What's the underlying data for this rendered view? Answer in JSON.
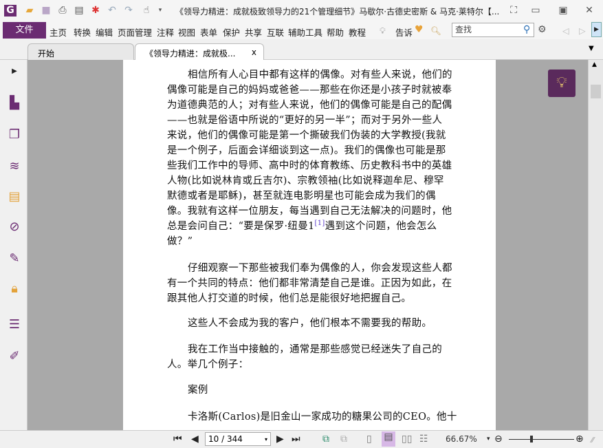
{
  "window": {
    "title": "《领导力精进：成就极致领导力的21个管理细节》马歇尔·古德史密斯 & 马克·莱特尔【..."
  },
  "menu": {
    "file": "文件",
    "items": [
      "主页",
      "转换",
      "编辑",
      "页面管理",
      "注释",
      "视图",
      "表单",
      "保护",
      "共享",
      "互联",
      "辅助工具",
      "帮助",
      "教程"
    ],
    "tell": "告诉",
    "search_placeholder": "查找"
  },
  "tabs": [
    {
      "label": "开始"
    },
    {
      "label": "《领导力精进：成就极...",
      "close": "x"
    }
  ],
  "document": {
    "lines": [
      "相信所有人心目中都有这样的偶像。对有些人来说，他们的",
      "偶像可能是自己的妈妈或爸爸——那些在你还是小孩子时就被奉",
      "为道德典范的人；对有些人来说，他们的偶像可能是自己的配偶",
      "——也就是俗语中所说的“更好的另一半”；而对于另外一些人",
      "来说，他们的偶像可能是第一个撕破我们伪装的大学教授(我就",
      "是一个例子，后面会详细谈到这一点)。我们的偶像也可能是那",
      "些我们工作中的导师、高中时的体育教练、历史教科书中的英雄",
      "人物(比如说林肯或丘吉尔)、宗教领袖(比如说释迦牟尼、穆罕",
      "默德或者是耶稣)，甚至就连电影明星也可能会成为我们的偶",
      "像。我就有这样一位朋友，每当遇到自己无法解决的问题时，他",
      "总是会问自己：“要是保罗·纽曼1",
      "做？”",
      "仔细观察一下那些被我们奉为偶像的人，你会发现这些人都",
      "有一个共同的特点：他们都非常清楚自己是谁。正因为如此，在",
      "跟其他人打交道的时候，他们总是能很好地把握自己。",
      "这些人不会成为我的客户，他们根本不需要我的帮助。",
      "我在工作当中接触的，通常是那些感觉已经迷失了自己的",
      "人。举几个例子：",
      "案例",
      "卡洛斯(Carlos)是旧金山一家成功的糖果公司的CEO。他十"
    ],
    "footnote": "[1]",
    "line11_tail": "遇到这个问题，他会怎么"
  },
  "status": {
    "page": "10 / 344",
    "zoom": "66.67%",
    "zoom_fraction": 0.33
  }
}
